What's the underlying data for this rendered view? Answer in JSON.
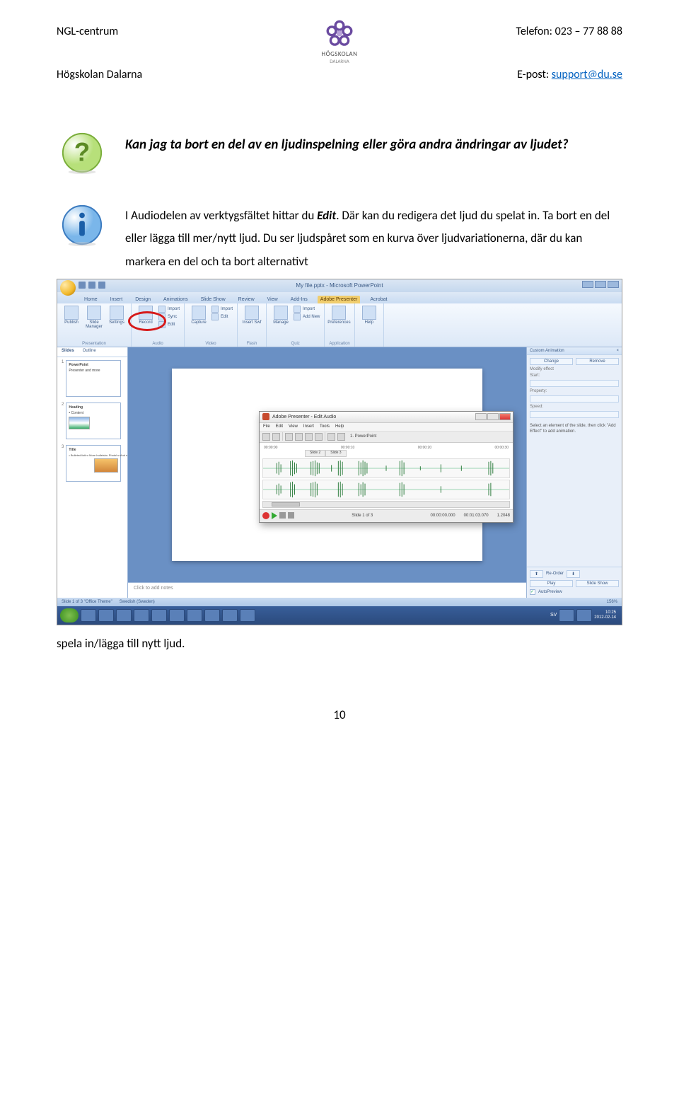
{
  "header": {
    "left1": "NGL-centrum",
    "left2": "Högskolan Dalarna",
    "right1_prefix": "Telefon: ",
    "right1_value": "023 – 77 88 88",
    "right2_prefix": "E-post: ",
    "right2_link": "support@du.se",
    "logo_name": "HÖGSKOLAN",
    "logo_sub": "DALARNA"
  },
  "question": {
    "text": "Kan jag ta bort en del av en ljudinspelning eller göra andra ändringar av ljudet?"
  },
  "info": {
    "before_emph": "I Audiodelen av verktygsfältet hittar du ",
    "emph": "Edit",
    "after_emph": ". Där kan du redigera det ljud du spelat in. Ta bort en del eller lägga till mer/nytt ljud. Du ser ljudspåret som en kurva över ljudvariationerna, där du kan markera en del och ta bort alternativt"
  },
  "after_text": "spela in/lägga till nytt ljud.",
  "page_number": "10",
  "ppt": {
    "title": "My file.pptx - Microsoft PowerPoint",
    "tabs": [
      "Home",
      "Insert",
      "Design",
      "Animations",
      "Slide Show",
      "Review",
      "View",
      "Add-Ins",
      "Adobe Presenter",
      "Acrobat"
    ],
    "ribbon": {
      "groups": [
        {
          "label": "Presentation",
          "btns": [
            "Publish",
            "Slide Manager",
            "Settings"
          ]
        },
        {
          "label": "Audio",
          "btns": [
            "Record",
            "Import",
            "Sync",
            "Edit"
          ],
          "stack": [
            "Import",
            "Edit"
          ]
        },
        {
          "label": "Video",
          "btns": [
            "Capture"
          ],
          "stack": [
            "Import",
            "Edit"
          ]
        },
        {
          "label": "Flash",
          "btns": [
            "Insert Swf"
          ]
        },
        {
          "label": "Quiz",
          "btns": [
            "Manage"
          ],
          "stack": [
            "Import",
            "Add New"
          ]
        },
        {
          "label": "Application",
          "btns": [
            "Preferences"
          ]
        },
        {
          "label": "",
          "btns": [
            "Help"
          ]
        }
      ]
    },
    "slides_tabs": [
      "Slides",
      "Outline"
    ],
    "thumbs": [
      {
        "num": "1",
        "title": "PowerPoint",
        "sub": "Presenter and more"
      },
      {
        "num": "2",
        "title": "Heading",
        "sub": "• Content"
      },
      {
        "num": "3",
        "title": "Title",
        "sub": "• Bulleted list\\n• More bullets\\n• Photo\\n• And more"
      }
    ],
    "notes": "Click to add notes",
    "anim": {
      "title": "Custom Animation",
      "add": "Add Effect",
      "change": "Change",
      "remove": "Remove",
      "modify": "Modify effect",
      "start": "Start:",
      "property": "Property:",
      "speed": "Speed:",
      "msg": "Select an element of the slide, then click \"Add Effect\" to add animation.",
      "reorder": "Re-Order",
      "play": "Play",
      "slideshow": "Slide Show",
      "autoprev": "AutoPreview"
    },
    "status": {
      "left": "Slide 1 of 3   \"Office Theme\"",
      "lang": "Swedish (Sweden)",
      "zoom": "156%"
    },
    "taskbar": {
      "time": "10:25",
      "date": "2012-02-14",
      "lang": "SV"
    }
  },
  "audio": {
    "title": "Adobe Presenter - Edit Audio",
    "menu": [
      "File",
      "Edit",
      "View",
      "Insert",
      "Tools",
      "Help"
    ],
    "pp_label": "1. PowerPoint",
    "times": [
      "00:00:00",
      "00:00:10",
      "00:00:20",
      "00:00:30"
    ],
    "slide_markers": [
      "Slide 2",
      "Slide 3"
    ],
    "status": {
      "slide": "Slide 1 of 3",
      "t1": "00:00:00.000",
      "t2": "00:01:03.070",
      "t3": "1.2048"
    }
  }
}
